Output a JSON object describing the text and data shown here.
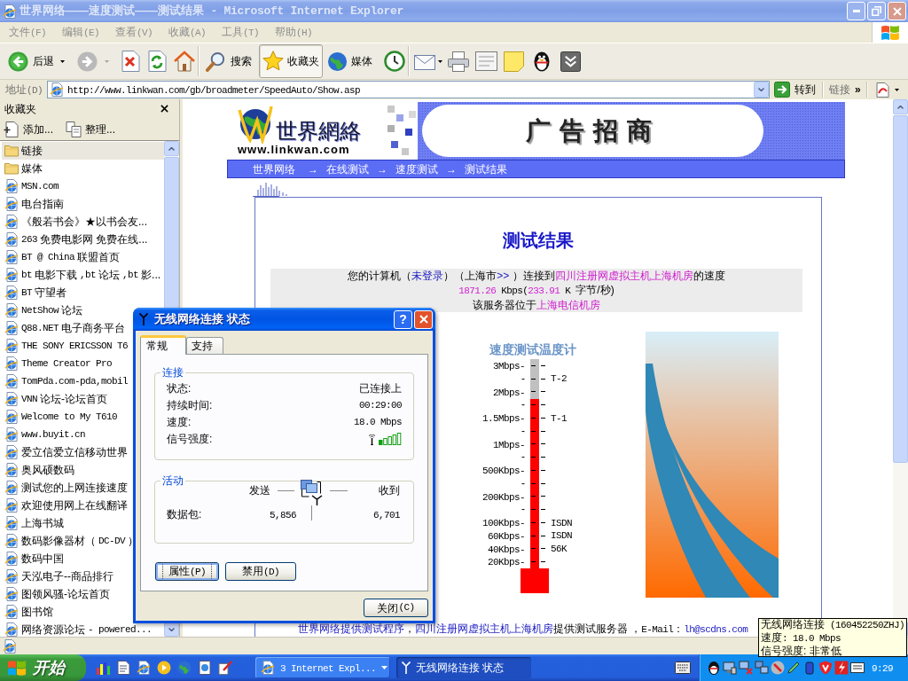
{
  "window": {
    "title": "世界网络——速度测试——测试结果 - Microsoft Internet Explorer",
    "active": false
  },
  "menu": [
    {
      "label": "文件(F)"
    },
    {
      "label": "编辑(E)"
    },
    {
      "label": "查看(V)"
    },
    {
      "label": "收藏(A)"
    },
    {
      "label": "工具(T)"
    },
    {
      "label": "帮助(H)"
    }
  ],
  "toolbar": {
    "back": {
      "label": "后退"
    },
    "forward": {
      "disabled": true
    },
    "search": {
      "label": "搜索",
      "pressed": false
    },
    "favorites": {
      "label": "收藏夹",
      "pressed": true
    },
    "media": {
      "label": "媒体",
      "pressed": false
    }
  },
  "address_bar": {
    "label": "地址(D)",
    "value": "http://www.linkwan.com/gb/broadmeter/SpeedAuto/Show.asp",
    "go": "转到",
    "links": "链接",
    "more": "»"
  },
  "favorites_pane": {
    "title": "收藏夹",
    "add": "添加...",
    "organize": "整理...",
    "items": [
      {
        "kind": "folder",
        "label": "链接",
        "selected": true
      },
      {
        "kind": "folder",
        "label": "媒体",
        "selected": false
      },
      {
        "kind": "link",
        "label": "MSN.com",
        "selected": false
      },
      {
        "kind": "link",
        "label": "电台指南",
        "selected": false
      },
      {
        "kind": "link",
        "label": "《般若书会》★以书会友...",
        "selected": false
      },
      {
        "kind": "link",
        "label": "263免费电影网 免费在线...",
        "selected": false
      },
      {
        "kind": "link",
        "label": "BT @ China 联盟首页",
        "selected": false
      },
      {
        "kind": "link",
        "label": "bt电影下载,bt论坛,bt影...",
        "selected": false
      },
      {
        "kind": "link",
        "label": "BT守望者",
        "selected": false
      },
      {
        "kind": "link",
        "label": "NetShow论坛",
        "selected": false
      },
      {
        "kind": "link",
        "label": "Q88.NET电子商务平台",
        "selected": false
      },
      {
        "kind": "link",
        "label": "THE SONY ERICSSON T6",
        "selected": false
      },
      {
        "kind": "link",
        "label": "Theme Creator Pro",
        "selected": false
      },
      {
        "kind": "link",
        "label": "TomPda.com-pda,mobil",
        "selected": false
      },
      {
        "kind": "link",
        "label": "VNN论坛-论坛首页",
        "selected": false
      },
      {
        "kind": "link",
        "label": "Welcome to My T610",
        "selected": false
      },
      {
        "kind": "link",
        "label": "www.buyit.cn",
        "selected": false
      },
      {
        "kind": "link",
        "label": "爱立信爱立信移动世界",
        "selected": false
      },
      {
        "kind": "link",
        "label": "奥风硕数码",
        "selected": false
      },
      {
        "kind": "link",
        "label": "测试您的上网连接速度",
        "selected": false
      },
      {
        "kind": "link",
        "label": "欢迎使用网上在线翻译",
        "selected": false
      },
      {
        "kind": "link",
        "label": "上海书城",
        "selected": false
      },
      {
        "kind": "link",
        "label": "数码影像器材（DC-DV）",
        "selected": false
      },
      {
        "kind": "link",
        "label": "数码中国",
        "selected": false
      },
      {
        "kind": "link",
        "label": "天泓电子--商品排行",
        "selected": false
      },
      {
        "kind": "link",
        "label": "图领风骚-论坛首页",
        "selected": false
      },
      {
        "kind": "link",
        "label": "图书馆",
        "selected": false
      },
      {
        "kind": "link",
        "label": "网络资源论坛 - powered...",
        "selected": false
      }
    ]
  },
  "page": {
    "logo": {
      "name": "世界網絡",
      "url": "www.linkwan.com"
    },
    "ad": "广告招商",
    "breadcrumb": {
      "items": [
        "世界网络",
        "在线测试",
        "速度测试",
        "测试结果"
      ],
      "separator": "→"
    },
    "heading": "测试结果",
    "result_lines": [
      [
        {
          "kind": "text",
          "text": "您的计算机（"
        },
        {
          "kind": "link",
          "text": "未登录"
        },
        {
          "kind": "text",
          "text": "）（上海市"
        },
        {
          "kind": "link",
          "text": ">>"
        },
        {
          "kind": "text",
          "text": " ）连接到"
        },
        {
          "kind": "accent",
          "text": "四川注册网虚拟主机上海机房"
        },
        {
          "kind": "text",
          "text": "的速度"
        }
      ],
      [
        {
          "kind": "accent",
          "text": "1871.26"
        },
        {
          "kind": "text",
          "text": " Kbps("
        },
        {
          "kind": "accent",
          "text": "233.91"
        },
        {
          "kind": "text",
          "text": " K 字节/秒)"
        }
      ],
      [
        {
          "kind": "text",
          "text": "该服务器位于"
        },
        {
          "kind": "accent",
          "text": "上海电信机房"
        }
      ]
    ],
    "thermometer": {
      "title": "速度测试温度计",
      "level": 0.81,
      "scale": [
        {
          "label": "3Mbps-"
        },
        {
          "label": "-",
          "note": "T-2"
        },
        {
          "label": "2Mbps-"
        },
        {
          "label": "-"
        },
        {
          "label": "1.5Mbps-",
          "note": "T-1"
        },
        {
          "label": "-"
        },
        {
          "label": "1Mbps-"
        },
        {
          "label": "-"
        },
        {
          "label": "500Kbps-"
        },
        {
          "label": "-"
        },
        {
          "label": "200Kbps-"
        },
        {
          "label": "-"
        },
        {
          "label": "100Kbps-",
          "note": "ISDN"
        },
        {
          "label": "60Kbps-",
          "note": "ISDN"
        },
        {
          "label": "40Kbps-",
          "note": "56K"
        },
        {
          "label": "20Kbps-"
        }
      ]
    },
    "footer": [
      {
        "kind": "link",
        "text": "世界网络提供测试程序"
      },
      {
        "kind": "text",
        "text": "，"
      },
      {
        "kind": "link",
        "text": "四川注册网虚拟主机上海机房"
      },
      {
        "kind": "text",
        "text": "提供测试服务器 ，E-Mail："
      },
      {
        "kind": "link",
        "text": "lh@scdns.com"
      }
    ]
  },
  "dialog": {
    "title": "无线网络连接 状态",
    "active": true,
    "help": "?",
    "tabs": [
      {
        "label": "常规",
        "selected": true
      },
      {
        "label": "支持",
        "selected": false
      }
    ],
    "connection": {
      "title": "连接",
      "rows": [
        {
          "kind": "text",
          "label": "状态:",
          "value": "已连接上"
        },
        {
          "kind": "text",
          "label": "持续时间:",
          "value": "00:29:00"
        },
        {
          "kind": "text",
          "label": "速度:",
          "value": "18.0 Mbps"
        },
        {
          "kind": "signal",
          "label": "信号强度:"
        }
      ]
    },
    "activity": {
      "title": "活动",
      "sent": "发送",
      "received": "收到",
      "packets_label": "数据包:",
      "packets_sent": "5,856",
      "packets_received": "6,701"
    },
    "buttons": [
      {
        "label": "属性(P)",
        "focused": true
      },
      {
        "label": "禁用(D)",
        "focused": false
      }
    ],
    "close": "关闭(C)"
  },
  "taskbar": {
    "start": "开始",
    "tasks": [
      {
        "kind": "group",
        "label": "3 Internet Expl...",
        "selected": false
      },
      {
        "kind": "window",
        "label": "无线网络连接 状态",
        "selected": true
      }
    ],
    "clock": "9:29"
  },
  "tooltip": {
    "title": "无线网络连接 (160452250ZHJ)",
    "lines": [
      "速度: 18.0 Mbps",
      "信号强度: 非常低"
    ]
  }
}
